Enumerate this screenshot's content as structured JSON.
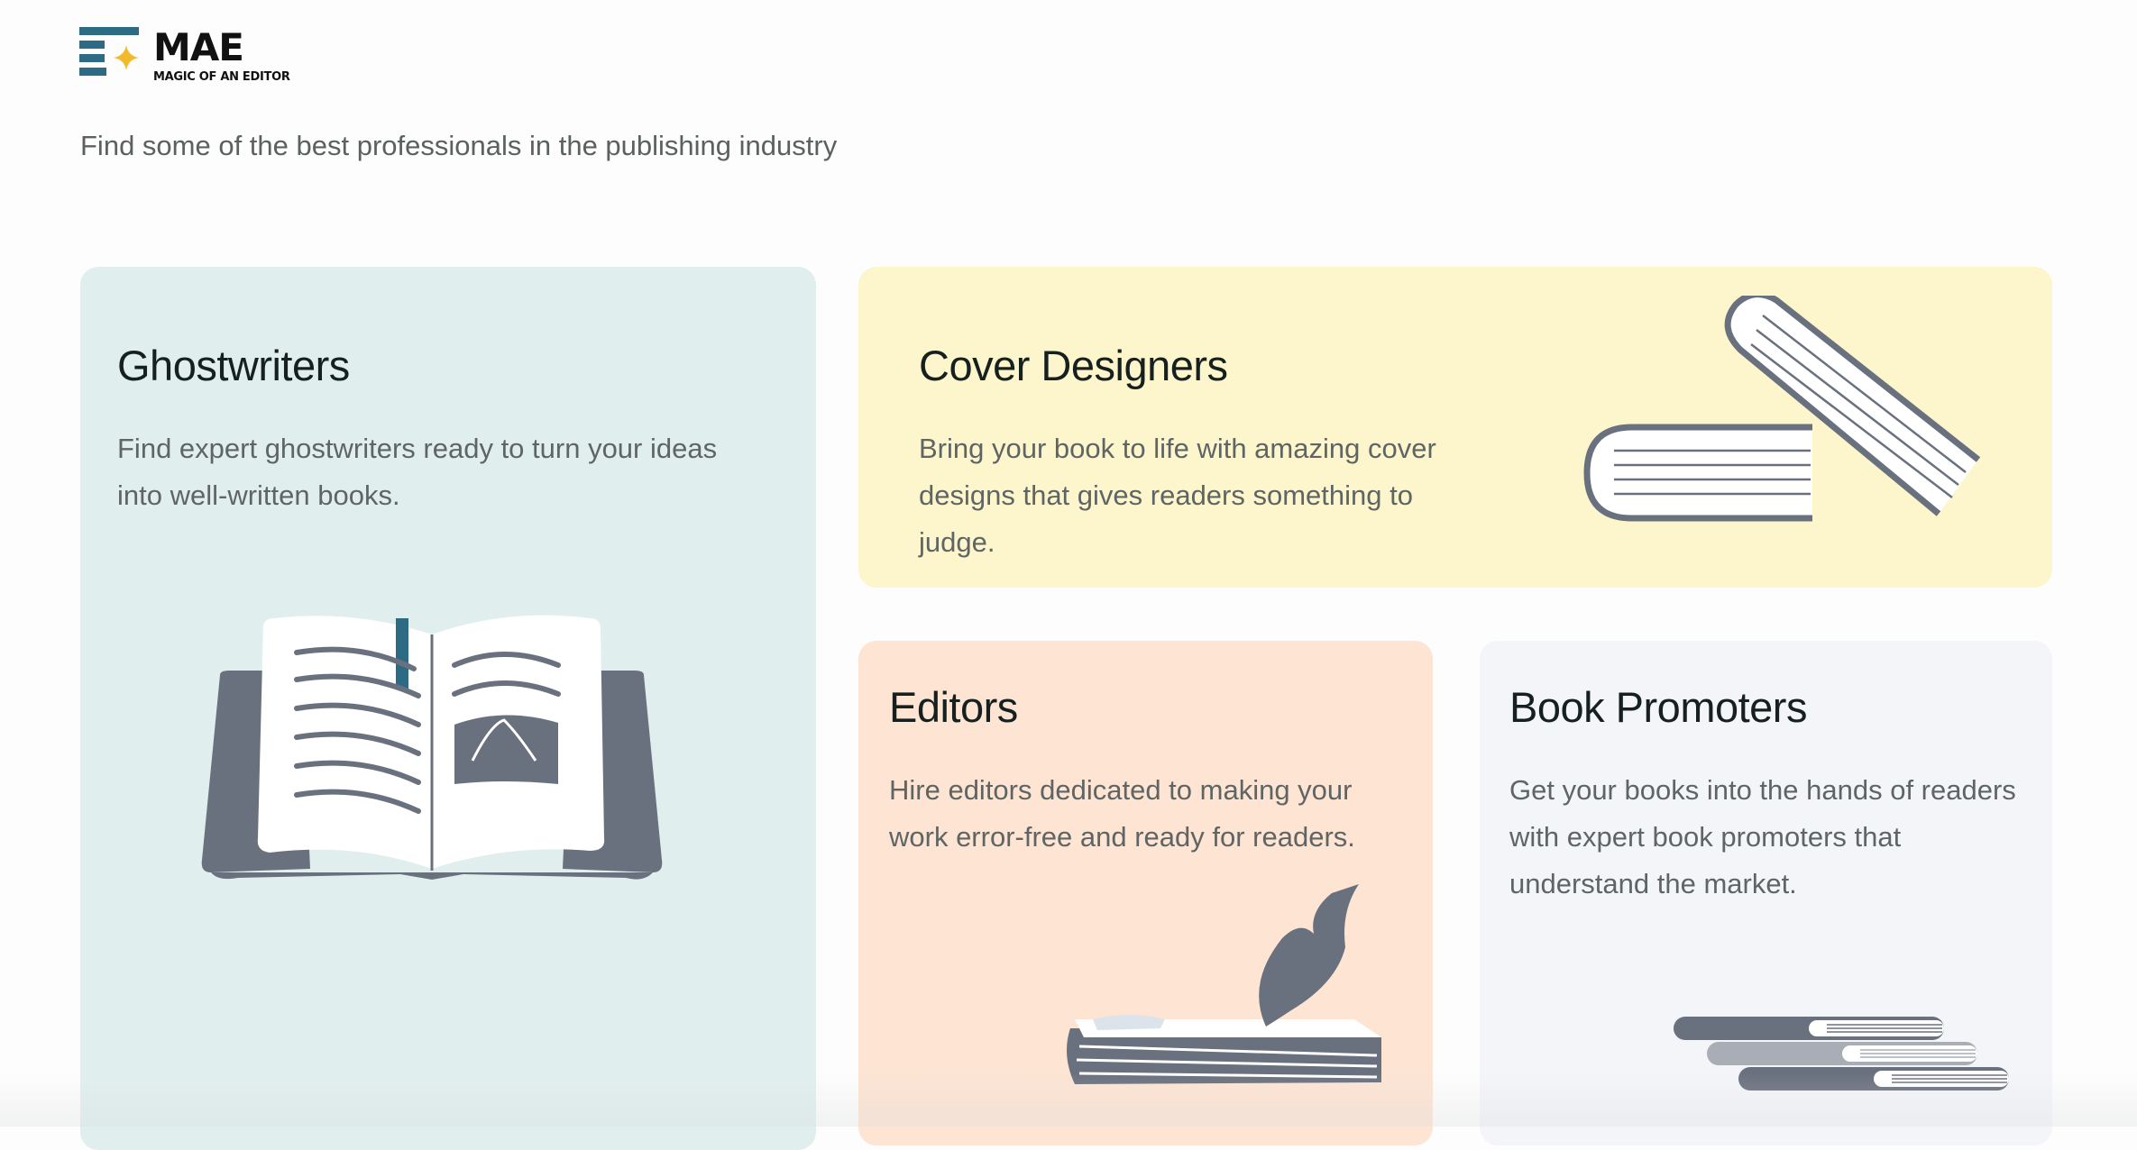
{
  "brand": {
    "name": "MAE",
    "subtitle": "MAGIC OF AN EDITOR",
    "colors": {
      "bars": "#2d6b85",
      "star": "#f2b92a"
    }
  },
  "tagline": "Find some of the best professionals in the publishing industry",
  "cards": [
    {
      "title": "Ghostwriters",
      "description": "Find expert ghostwriters ready to turn your ideas into well-written books.",
      "color": "#e0efee",
      "illustration": "open-book-icon"
    },
    {
      "title": "Cover Designers",
      "description": "Bring your book to life with amazing cover designs that gives readers something to judge.",
      "color": "#fdf6cc",
      "illustration": "two-books-icon"
    },
    {
      "title": "Editors",
      "description": "Hire editors dedicated to making your work error-free and ready for readers.",
      "color": "#fde4d3",
      "illustration": "book-with-quill-icon"
    },
    {
      "title": "Book Promoters",
      "description": "Get your books into the hands of readers with expert book promoters that understand the market.",
      "color": "#f4f5f9",
      "illustration": "book-stack-icon"
    }
  ]
}
